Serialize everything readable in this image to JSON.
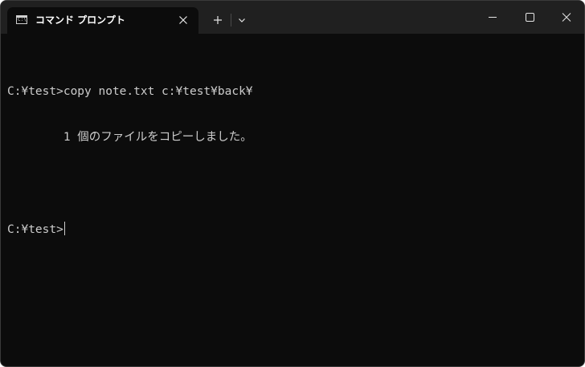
{
  "window": {
    "tab_title": "コマンド プロンプト",
    "tab_icon_text": "C:\\"
  },
  "colors": {
    "titlebar": "#202020",
    "terminal_background": "#0c0c0c",
    "terminal_text": "#cccccc",
    "tab_title_text": "#ffffff"
  },
  "icons": {
    "tab": "console-icon",
    "tab_close": "close-icon",
    "new_tab": "plus-icon",
    "dropdown": "chevron-down-icon",
    "minimize": "minimize-icon",
    "maximize": "maximize-icon",
    "close": "close-icon"
  },
  "terminal": {
    "lines": [
      "C:¥test>copy note.txt c:¥test¥back¥",
      "        1 個のファイルをコピーしました。",
      "",
      "C:¥test>"
    ]
  }
}
